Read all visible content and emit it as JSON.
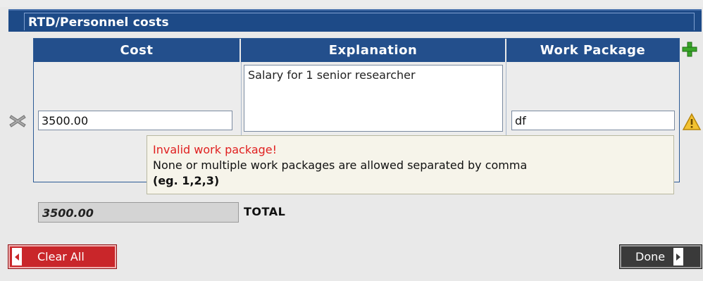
{
  "section": {
    "title": "RTD/Personnel costs"
  },
  "table": {
    "headers": [
      "Cost",
      "Explanation",
      "Work Package"
    ],
    "row": {
      "cost": "3500.00",
      "explanation": "Salary for 1 senior researcher",
      "work_package": "df"
    }
  },
  "tooltip": {
    "error": "Invalid work package!",
    "message": "None or multiple work packages are allowed separated by comma",
    "example": "(eg. 1,2,3)"
  },
  "total": {
    "value": "3500.00",
    "label": "TOTAL"
  },
  "buttons": {
    "clear_all": "Clear All",
    "done": "Done"
  },
  "icons": {
    "add": "add-row-icon",
    "remove": "remove-row-icon",
    "warning": "warning-icon"
  },
  "colors": {
    "header_blue": "#234f8c",
    "error_red": "#e02020",
    "clear_red": "#c9262a"
  }
}
